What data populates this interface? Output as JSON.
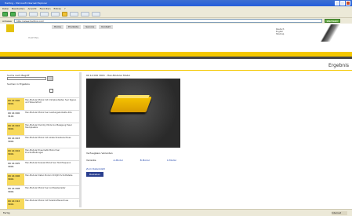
{
  "window": {
    "title": "Harting - Microsoft Internet Explorer"
  },
  "menu": [
    "Datei",
    "Bearbeiten",
    "Ansicht",
    "Favoriten",
    "Extras",
    "?"
  ],
  "address": {
    "label": "Adresse",
    "url": "http://www.harting.com",
    "go_label": "Wechseln zu"
  },
  "header": {
    "company": "HARTING",
    "nav": [
      "Home",
      "Produkte",
      "Service",
      "Kontakt"
    ],
    "right_info": [
      "Deutsch",
      "English",
      "Sitemap"
    ]
  },
  "section": {
    "title": "Ergebnis"
  },
  "search": {
    "label": "Suche nach Begriff",
    "sub_label": "Suchen in Ergebnis"
  },
  "results": [
    {
      "code": "09 14 000 3001",
      "desc": "Han-Modular Modul mit Crimpkontakten fuer Signal- und Steuerstrom"
    },
    {
      "code": "09 14 000 3101",
      "desc": "Han-Modular Modul fuer Leistungskontakte 40A"
    },
    {
      "code": "09 14 002 3001",
      "desc": "Han-Modular Dummy Modul zur Belegung freier Steckplaetze"
    },
    {
      "code": "09 14 003 3001",
      "desc": "Han-Modular Modul mit Axialschraubanschluss"
    },
    {
      "code": "09 14 004 3001",
      "desc": "Han-Modular Pneumatik Modul fuer Druckluftleitungen"
    },
    {
      "code": "09 14 005 3001",
      "desc": "Han-Modular Koaxial Modul fuer Hochfrequenz"
    },
    {
      "code": "09 14 006 3001",
      "desc": "Han-Modular Daten Modul mit RJ45 Schnittstelle"
    },
    {
      "code": "09 14 008 3001",
      "desc": "Han-Modular Modul fuer Lichtwellenleiter"
    },
    {
      "code": "09 14 012 3001",
      "desc": "Han-Modular Modul mit Federkraftanschluss"
    }
  ],
  "product": {
    "title": "09 14 000 3001 - Han-Modular Modul",
    "variants_label": "Verfuegbare Varianten",
    "options_label": "Variante",
    "options": [
      "A-Modul",
      "B-Modul",
      "C-Modul"
    ],
    "detail_link": "Zum Datenblatt",
    "action": "Bestellen"
  },
  "status": {
    "text": "Fertig",
    "zone": "Internet"
  }
}
